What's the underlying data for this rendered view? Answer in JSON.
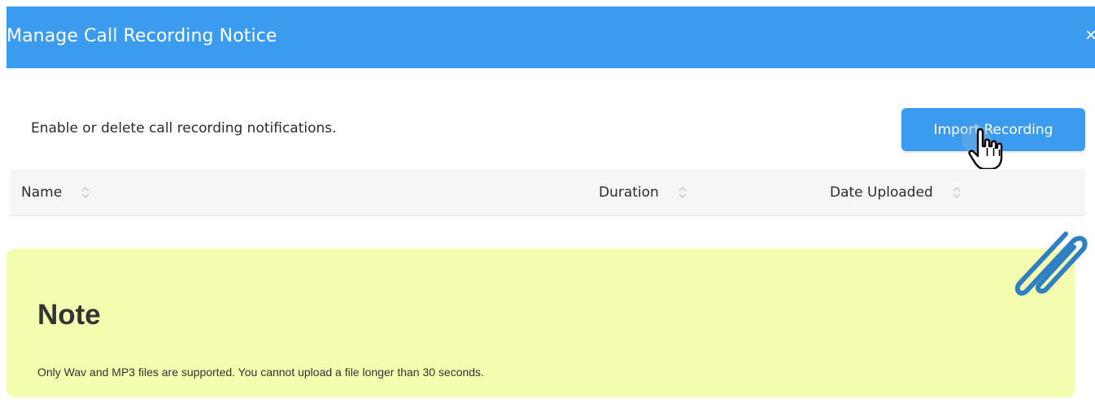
{
  "header": {
    "title": "Manage Call Recording Notice",
    "close_label": "×"
  },
  "toolbar": {
    "description": "Enable or delete call recording notifications.",
    "import_label": "Import Recording"
  },
  "table": {
    "columns": [
      {
        "label": "Name"
      },
      {
        "label": "Duration"
      },
      {
        "label": "Date Uploaded"
      }
    ],
    "rows": []
  },
  "note": {
    "title": "Note",
    "text": "Only Wav and MP3 files are supported. You cannot upload a file longer than 30 seconds."
  },
  "icons": {
    "sort": "sort-icon",
    "cursor": "hand-pointer-icon",
    "clip": "paperclip-icon",
    "close": "close-icon"
  },
  "colors": {
    "accent": "#3a9bef",
    "note_bg": "#f4fcaf",
    "clip": "#2f7fc3"
  }
}
